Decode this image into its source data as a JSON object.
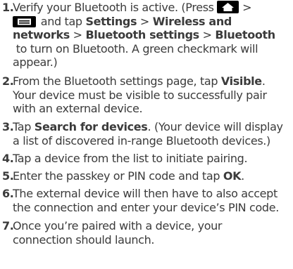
{
  "steps": [
    {
      "number": "1.",
      "l1": {
        "t1": "Verify your Bluetooth is active. (Press ",
        "icon": "home-key-icon",
        "t2": " >"
      },
      "l2": {
        "icon": "menu-key-icon",
        "t1": " and tap ",
        "b1": "Settings",
        "t2": " > ",
        "b2": "Wireless and"
      },
      "l3": {
        "b1": "networks",
        "t1": " > ",
        "b2": "Bluetooth settings",
        "t2": " > ",
        "b3": "Bluetooth"
      },
      "l4": " to turn on Bluetooth. A green checkmark will",
      "l5": "appear.)"
    },
    {
      "number": "2.",
      "l1": {
        "t1": "From the Bluetooth settings page, tap ",
        "b1": "Visible",
        "t2": "."
      },
      "l2": "Your device must be visible to successfully pair",
      "l3": "with an external device."
    },
    {
      "number": "3.",
      "l1": {
        "t1": "Tap ",
        "b1": "Search for devices",
        "t2": ". (Your device will display"
      },
      "l2": "a list of discovered in-range Bluetooth devices.)"
    },
    {
      "number": "4.",
      "l1": "Tap a device from the list to initiate pairing."
    },
    {
      "number": "5.",
      "l1": {
        "t1": "Enter the passkey or PIN code and tap ",
        "b1": "OK",
        "t2": "."
      }
    },
    {
      "number": "6.",
      "l1": "The external device will then have to also accept",
      "l2": "the connection and enter your device’s PIN code."
    },
    {
      "number": "7.",
      "l1": "Once you’re paired with a device, your",
      "l2": "connection should launch."
    }
  ]
}
